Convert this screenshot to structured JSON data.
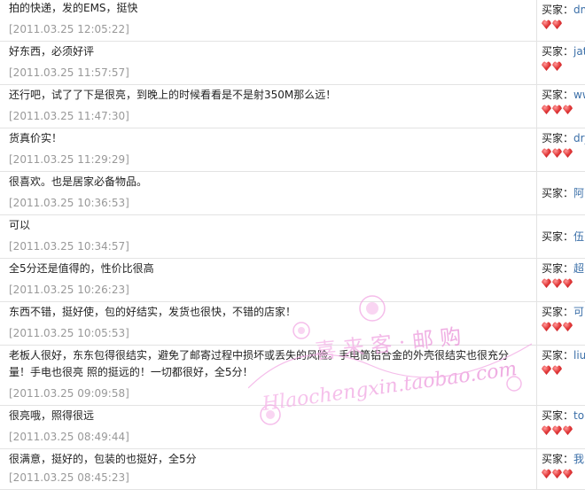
{
  "buyer_prefix": "买家：",
  "reviews": [
    {
      "comment": "拍的快递，发的EMS，挺快",
      "date": "[2011.03.25 12:05:22]",
      "buyer": "dm",
      "hearts": 2
    },
    {
      "comment": "好东西，必须好评",
      "date": "[2011.03.25 11:57:57]",
      "buyer": "jat",
      "hearts": 2
    },
    {
      "comment": "还行吧，试了了下是很亮，到晚上的时候看看是不是射350M那么远！",
      "date": "[2011.03.25 11:47:30]",
      "buyer": "ww",
      "hearts": 3
    },
    {
      "comment": "货真价实！",
      "date": "[2011.03.25 11:29:29]",
      "buyer": "dr_",
      "hearts": 3
    },
    {
      "comment": "很喜欢。也是居家必备物品。",
      "date": "[2011.03.25 10:36:53]",
      "buyer": "阿",
      "hearts": 0
    },
    {
      "comment": "可以",
      "date": "[2011.03.25 10:34:57]",
      "buyer": "伍",
      "hearts": 0
    },
    {
      "comment": "全5分还是值得的，性价比很高",
      "date": "[2011.03.25 10:26:23]",
      "buyer": "超",
      "hearts": 3
    },
    {
      "comment": "东西不错，挺好使，包的好结实，发货也很快，不错的店家！",
      "date": "[2011.03.25 10:05:53]",
      "buyer": "可",
      "hearts": 3
    },
    {
      "comment": "老板人很好，东东包得很结实，避免了邮寄过程中损坏或丢失的风险。手电筒铝合金的外壳很结实也很充分量！手电也很亮 照的挺远的！一切都很好，全5分！",
      "date": "[2011.03.25 09:09:58]",
      "buyer": "liu",
      "hearts": 2
    },
    {
      "comment": "很亮哦，照得很远",
      "date": "[2011.03.25 08:49:44]",
      "buyer": "tor",
      "hearts": 3
    },
    {
      "comment": "很满意，挺好的，包装的也挺好，全5分",
      "date": "[2011.03.25 08:45:23]",
      "buyer": "我",
      "hearts": 3
    }
  ],
  "watermark": {
    "cn": "喜 来 客 · 邮 购",
    "url": "Hlaochengxin.taobao.com"
  }
}
